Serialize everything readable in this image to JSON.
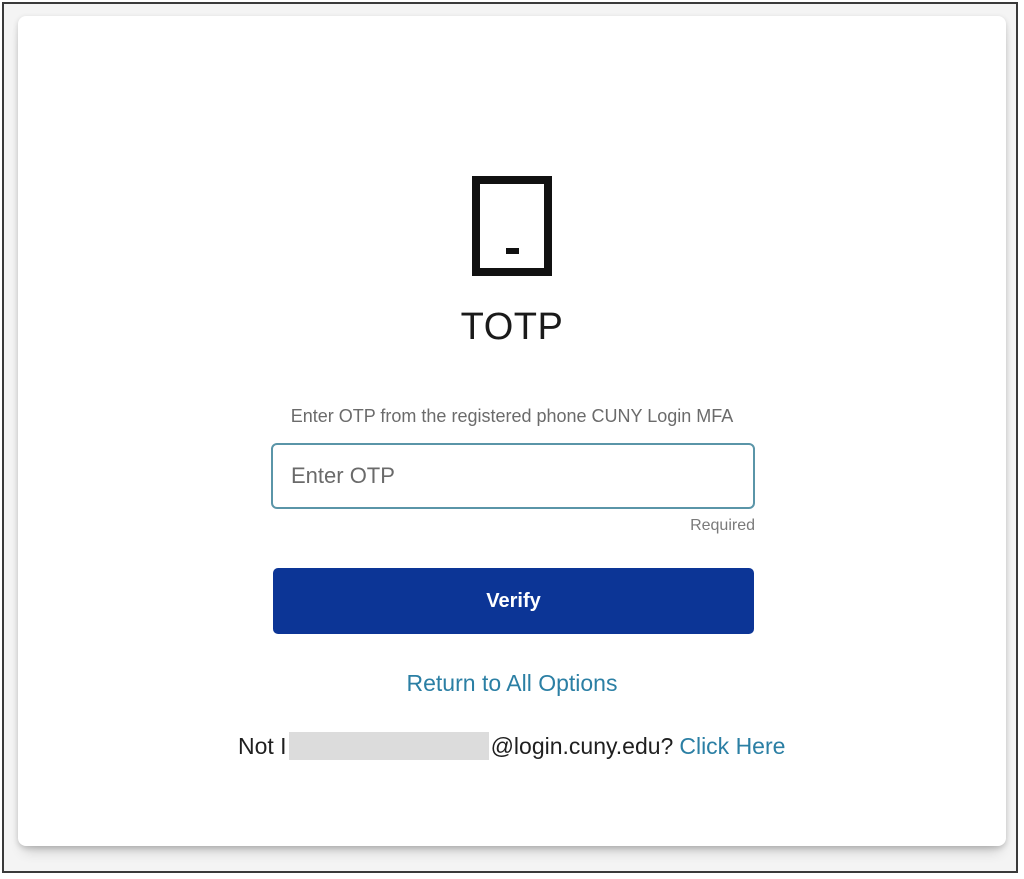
{
  "icon": "phone-icon",
  "title": "TOTP",
  "instruction": "Enter OTP from the registered phone CUNY Login MFA",
  "otp_field": {
    "placeholder": "Enter OTP",
    "value": "",
    "required_label": "Required"
  },
  "verify_label": "Verify",
  "return_link": "Return to All Options",
  "not_user": {
    "prefix": "Not I",
    "domain": "@login.cuny.edu?",
    "link": "Click Here"
  },
  "colors": {
    "primary_button": "#0c3596",
    "link": "#2b7fa4",
    "input_border": "#5a95a8"
  }
}
